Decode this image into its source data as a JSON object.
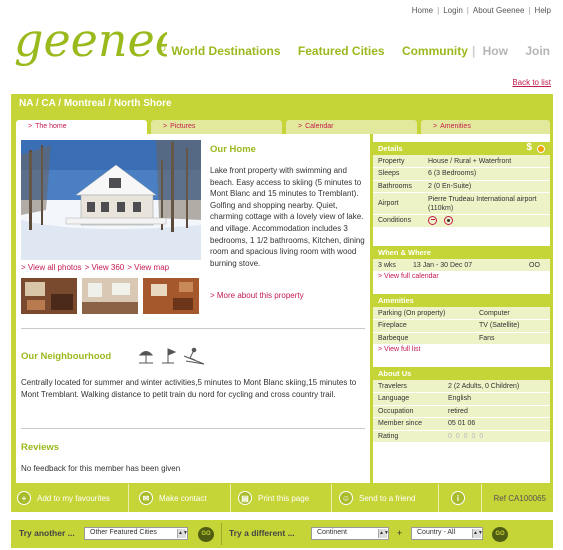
{
  "top_links": [
    "Home",
    "Login",
    "About Geenee",
    "Help"
  ],
  "logo_text": "geenee",
  "main_nav": [
    {
      "label": "World Destinations",
      "style": "green"
    },
    {
      "label": "Featured Cities",
      "style": "green"
    },
    {
      "label": "Community",
      "style": "green"
    },
    {
      "label": "How",
      "style": "grey"
    },
    {
      "label": "Join",
      "style": "grey"
    }
  ],
  "back_link": "Back to list",
  "breadcrumb": "NA / CA / Montreal / North Shore",
  "tabs": [
    {
      "label": "The home",
      "active": true
    },
    {
      "label": "Pictures",
      "active": false
    },
    {
      "label": "Calendar",
      "active": false
    },
    {
      "label": "Amenities",
      "active": false
    }
  ],
  "photo_links": [
    "> View all photos",
    "> View 360",
    "> View map"
  ],
  "home": {
    "title": "Our Home",
    "text": "Lake front property with swimming and beach. Easy access to skiing (5 minutes to Mont Blanc and 15 minutes to Tremblant). Golfing and shopping nearby. Quiet, charming cottage with a lovely view of lake. and village. Accommodation includes 3 bedrooms, 1 1/2 bathrooms, Kitchen, dining room and spacious living room with wood burning stove.",
    "more": "> More about this property"
  },
  "neighbourhood": {
    "title": "Our Neighbourhood",
    "text": "Centrally located for summer and winter activities,5 minutes to Mont Blanc skiing,15 minutes to Mont Tremblant. Walking distance to petit train du nord for cycling and cross country trail."
  },
  "reviews": {
    "title": "Reviews",
    "text": "No feedback for this member has been given"
  },
  "details": {
    "title": "Details",
    "rows": [
      {
        "k": "Property",
        "v": "House / Rural + Waterfront"
      },
      {
        "k": "Sleeps",
        "v": "6 (3 Bedrooms)"
      },
      {
        "k": "Bathrooms",
        "v": "2 (0 En-Suite)"
      },
      {
        "k": "Airport",
        "v": "Pierre Trudeau International airport (110km)"
      },
      {
        "k": "Conditions",
        "v": ""
      }
    ]
  },
  "when_where": {
    "title": "When & Where",
    "duration": "3 wks",
    "dates": "13 Jan - 30 Dec 07",
    "code": "OO",
    "link": "> View full calendar"
  },
  "amenities": {
    "title": "Amenities",
    "rows": [
      [
        "Parking (On property)",
        "Computer"
      ],
      [
        "Fireplace",
        "TV (Satellite)"
      ],
      [
        "Barbeque",
        "Fans"
      ]
    ],
    "link": "> View full list"
  },
  "about": {
    "title": "About Us",
    "rows": [
      {
        "k": "Travelers",
        "v": "2 (2 Adults, 0 Children)"
      },
      {
        "k": "Language",
        "v": "English"
      },
      {
        "k": "Occupation",
        "v": "retired"
      },
      {
        "k": "Member since",
        "v": "05 01 06"
      },
      {
        "k": "Rating",
        "v": "0 0 0 0 0"
      }
    ]
  },
  "actions": [
    "Add to my favourites",
    "Make contact",
    "Print this page",
    "Send to a friend"
  ],
  "ref": "Ref CA100065",
  "bottom": {
    "try_another": "Try another ...",
    "featured_select": "Other Featured Cities",
    "go": "GO",
    "try_different": "Try a different ...",
    "continent_select": "Continent",
    "plus": "+",
    "country_select": "Country - All"
  },
  "colors": {
    "accent": "#c5d436",
    "logo": "#9ab91d",
    "link": "#c31b4f"
  }
}
